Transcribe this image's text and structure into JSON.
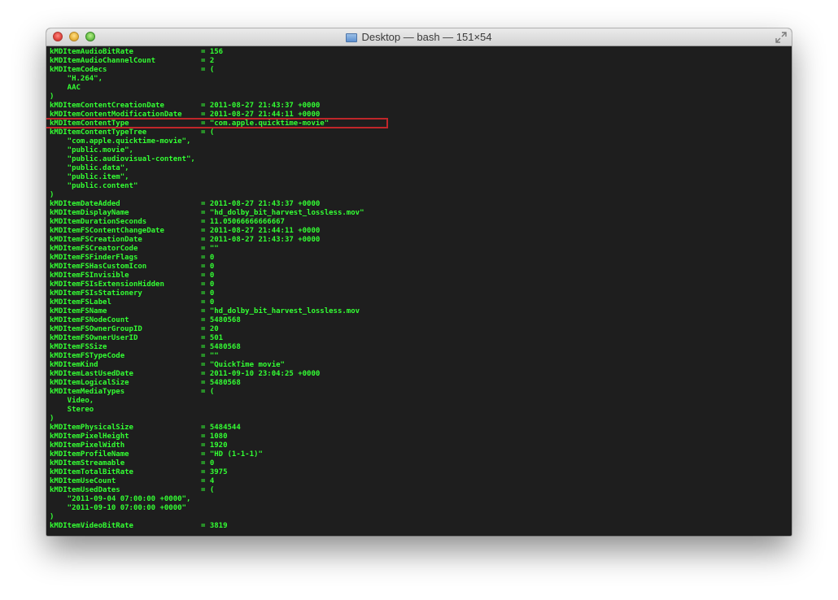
{
  "window": {
    "title": "Desktop — bash — 151×54"
  },
  "terminal": {
    "lines": [
      {
        "key": "kMDItemAudioBitRate",
        "value": "= 156"
      },
      {
        "key": "kMDItemAudioChannelCount",
        "value": "= 2"
      },
      {
        "key": "kMDItemCodecs",
        "value": "= ("
      },
      {
        "key": "",
        "value": "    \"H.264\","
      },
      {
        "key": "",
        "value": "    AAC"
      },
      {
        "key": "",
        "value": ")"
      },
      {
        "key": "kMDItemContentCreationDate",
        "value": "= 2011-08-27 21:43:37 +0000"
      },
      {
        "key": "kMDItemContentModificationDate",
        "value": "= 2011-08-27 21:44:11 +0000"
      },
      {
        "key": "kMDItemContentType",
        "value": "= \"com.apple.quicktime-movie\""
      },
      {
        "key": "kMDItemContentTypeTree",
        "value": "= ("
      },
      {
        "key": "",
        "value": "    \"com.apple.quicktime-movie\","
      },
      {
        "key": "",
        "value": "    \"public.movie\","
      },
      {
        "key": "",
        "value": "    \"public.audiovisual-content\","
      },
      {
        "key": "",
        "value": "    \"public.data\","
      },
      {
        "key": "",
        "value": "    \"public.item\","
      },
      {
        "key": "",
        "value": "    \"public.content\""
      },
      {
        "key": "",
        "value": ")"
      },
      {
        "key": "kMDItemDateAdded",
        "value": "= 2011-08-27 21:43:37 +0000"
      },
      {
        "key": "kMDItemDisplayName",
        "value": "= \"hd_dolby_bit_harvest_lossless.mov\""
      },
      {
        "key": "kMDItemDurationSeconds",
        "value": "= 11.05066666666667"
      },
      {
        "key": "kMDItemFSContentChangeDate",
        "value": "= 2011-08-27 21:44:11 +0000"
      },
      {
        "key": "kMDItemFSCreationDate",
        "value": "= 2011-08-27 21:43:37 +0000"
      },
      {
        "key": "kMDItemFSCreatorCode",
        "value": "= \"\""
      },
      {
        "key": "kMDItemFSFinderFlags",
        "value": "= 0"
      },
      {
        "key": "kMDItemFSHasCustomIcon",
        "value": "= 0"
      },
      {
        "key": "kMDItemFSInvisible",
        "value": "= 0"
      },
      {
        "key": "kMDItemFSIsExtensionHidden",
        "value": "= 0"
      },
      {
        "key": "kMDItemFSIsStationery",
        "value": "= 0"
      },
      {
        "key": "kMDItemFSLabel",
        "value": "= 0"
      },
      {
        "key": "kMDItemFSName",
        "value": "= \"hd_dolby_bit_harvest_lossless.mov"
      },
      {
        "key": "kMDItemFSNodeCount",
        "value": "= 5480568"
      },
      {
        "key": "kMDItemFSOwnerGroupID",
        "value": "= 20"
      },
      {
        "key": "kMDItemFSOwnerUserID",
        "value": "= 501"
      },
      {
        "key": "kMDItemFSSize",
        "value": "= 5480568"
      },
      {
        "key": "kMDItemFSTypeCode",
        "value": "= \"\""
      },
      {
        "key": "kMDItemKind",
        "value": "= \"QuickTime movie\""
      },
      {
        "key": "kMDItemLastUsedDate",
        "value": "= 2011-09-10 23:04:25 +0000"
      },
      {
        "key": "kMDItemLogicalSize",
        "value": "= 5480568"
      },
      {
        "key": "kMDItemMediaTypes",
        "value": "= ("
      },
      {
        "key": "",
        "value": "    Video,"
      },
      {
        "key": "",
        "value": "    Stereo"
      },
      {
        "key": "",
        "value": ")"
      },
      {
        "key": "kMDItemPhysicalSize",
        "value": "= 5484544"
      },
      {
        "key": "kMDItemPixelHeight",
        "value": "= 1080"
      },
      {
        "key": "kMDItemPixelWidth",
        "value": "= 1920"
      },
      {
        "key": "kMDItemProfileName",
        "value": "= \"HD (1-1-1)\""
      },
      {
        "key": "kMDItemStreamable",
        "value": "= 0"
      },
      {
        "key": "kMDItemTotalBitRate",
        "value": "= 3975"
      },
      {
        "key": "kMDItemUseCount",
        "value": "= 4"
      },
      {
        "key": "kMDItemUsedDates",
        "value": "= ("
      },
      {
        "key": "",
        "value": "    \"2011-09-04 07:00:00 +0000\","
      },
      {
        "key": "",
        "value": "    \"2011-09-10 07:00:00 +0000\""
      },
      {
        "key": "",
        "value": ")"
      },
      {
        "key": "kMDItemVideoBitRate",
        "value": "= 3819"
      }
    ]
  },
  "colors": {
    "terminal_background": "#1e1e1e",
    "terminal_text": "#33ff33",
    "highlight_border": "#c0262a"
  },
  "icons": {
    "close": "close-button",
    "minimize": "minimize-button",
    "zoom": "zoom-button",
    "title_folder": "folder-icon",
    "fullscreen": "fullscreen-icon"
  }
}
